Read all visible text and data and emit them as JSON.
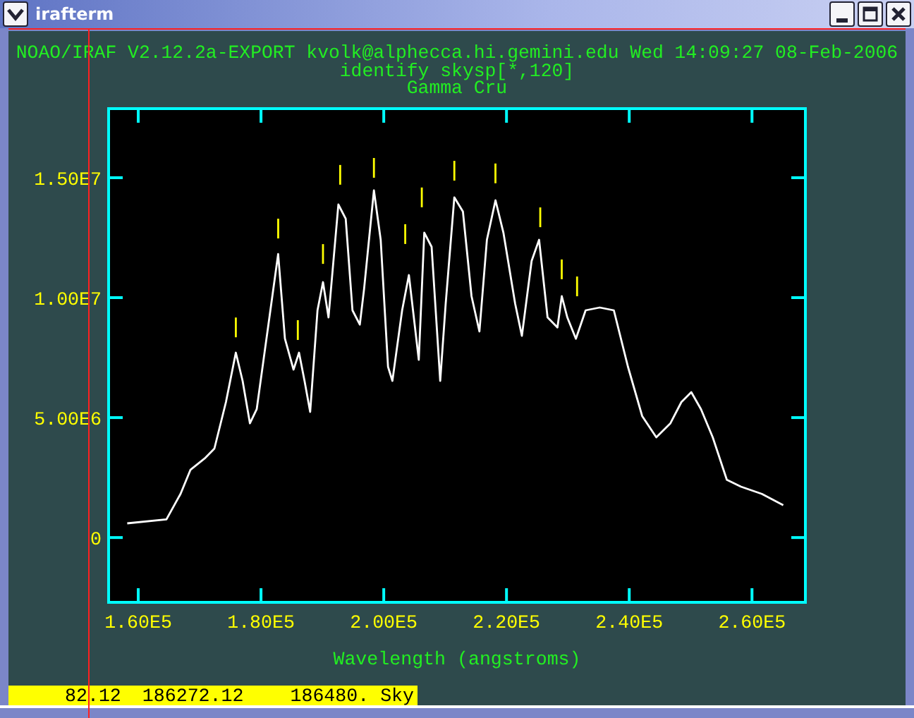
{
  "window": {
    "title": "irafterm"
  },
  "header": [
    "NOAO/IRAF V2.12.2a-EXPORT kvolk@alphecca.hi.gemini.edu Wed 14:09:27 08-Feb-2006",
    "identify skysp[*,120]",
    "Gamma Cru"
  ],
  "plot": {
    "chart_data": {
      "type": "line",
      "xlabel": "Wavelength (angstroms)",
      "x": [
        158200,
        164600,
        166900,
        168500,
        170800,
        172400,
        174300,
        175900,
        177000,
        178200,
        179300,
        181200,
        182800,
        183900,
        185300,
        186200,
        187100,
        188000,
        189200,
        190100,
        191000,
        192600,
        193800,
        194900,
        196100,
        196800,
        198400,
        199500,
        200700,
        201400,
        203000,
        204100,
        205700,
        206600,
        207800,
        209200,
        210100,
        211500,
        212900,
        214300,
        215600,
        216800,
        218200,
        219500,
        221400,
        222500,
        224100,
        225300,
        226700,
        228300,
        229000,
        229900,
        231300,
        232900,
        235200,
        237500,
        239800,
        242100,
        244400,
        246700,
        248500,
        250100,
        251700,
        253600,
        255900,
        258200,
        261600,
        265100
      ],
      "series": [
        {
          "color": "#ffffff",
          "values": [
            590000,
            760000,
            1820000,
            2820000,
            3290000,
            3710000,
            5650000,
            7710000,
            6530000,
            4760000,
            5350000,
            8880000,
            11820000,
            8290000,
            7000000,
            7710000,
            6530000,
            5240000,
            9470000,
            10650000,
            9180000,
            13880000,
            13290000,
            9470000,
            8880000,
            10350000,
            14470000,
            12410000,
            7120000,
            6530000,
            9470000,
            10940000,
            7410000,
            12710000,
            12120000,
            6530000,
            9760000,
            14180000,
            13590000,
            10060000,
            8590000,
            12410000,
            14060000,
            12710000,
            9760000,
            8410000,
            11530000,
            12410000,
            9180000,
            8760000,
            10060000,
            9180000,
            8290000,
            9470000,
            9590000,
            9470000,
            7120000,
            5060000,
            4180000,
            4760000,
            5650000,
            6060000,
            5350000,
            4180000,
            2410000,
            2120000,
            1820000,
            1350000
          ]
        }
      ],
      "xlim": [
        155170,
        268700
      ],
      "ylim": [
        -2700000,
        17880000
      ],
      "xticks": [
        {
          "value": 160000,
          "label": "1.60E5"
        },
        {
          "value": 180000,
          "label": "1.80E5"
        },
        {
          "value": 200000,
          "label": "2.00E5"
        },
        {
          "value": 220000,
          "label": "2.20E5"
        },
        {
          "value": 240000,
          "label": "2.40E5"
        },
        {
          "value": 260000,
          "label": "2.60E5"
        }
      ],
      "yticks": [
        {
          "value": 0,
          "label": "0"
        },
        {
          "value": 5000000,
          "label": "5.00E6"
        },
        {
          "value": 10000000,
          "label": "1.00E7"
        },
        {
          "value": 15000000,
          "label": "1.50E7"
        }
      ]
    }
  },
  "status_bar": [
    "82.12",
    "186272.12",
    "186480. Sky"
  ]
}
